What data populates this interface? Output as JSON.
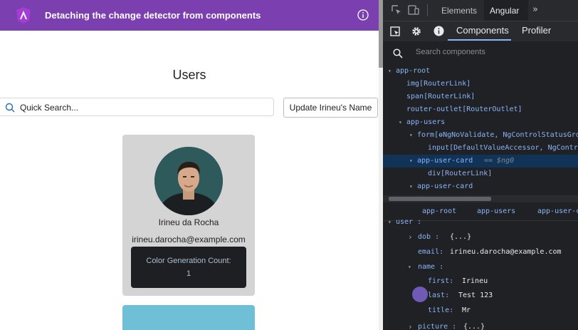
{
  "app": {
    "title": "Detaching the change detector from components",
    "heading": "Users",
    "search": {
      "value": "Quick Search..."
    },
    "update_button": "Update Irineu's Name",
    "user_card": {
      "name": "Irineu da Rocha",
      "email": "irineu.darocha@example.com",
      "counter_label": "Color Generation Count:",
      "counter_value": "1"
    }
  },
  "devtools": {
    "tabs": [
      "Elements",
      "Angular"
    ],
    "more_tabs": "»",
    "angular_tabs": [
      "Components",
      "Profiler"
    ],
    "search_placeholder": "Search components",
    "tree": [
      {
        "arrow": "▾",
        "label": "app-root"
      },
      {
        "arrow": "",
        "label": "img[RouterLink]"
      },
      {
        "arrow": "",
        "label": "span[RouterLink]"
      },
      {
        "arrow": "",
        "label": "router-outlet[RouterOutlet]"
      },
      {
        "arrow": "▾",
        "label": "app-users"
      },
      {
        "arrow": "▾",
        "label": "form[ɵNgNoValidate, NgControlStatusGro"
      },
      {
        "arrow": "",
        "label": "input[DefaultValueAccessor, NgContro"
      },
      {
        "arrow": "▾",
        "label": "app-user-card",
        "note": "== $ng0"
      },
      {
        "arrow": "",
        "label": "div[RouterLink]"
      },
      {
        "arrow": "▾",
        "label": "app-user-card"
      }
    ],
    "breadcrumbs": [
      "app-root",
      "app-users",
      "app-user-ca"
    ],
    "properties": [
      {
        "arrow": "▾",
        "key": "user :",
        "value": ""
      },
      {
        "arrow": "›",
        "key": "dob :",
        "value": "{...}"
      },
      {
        "arrow": "",
        "key": "email:",
        "value": "irineu.darocha@example.com"
      },
      {
        "arrow": "▾",
        "key": "name :",
        "value": ""
      },
      {
        "arrow": "",
        "key": "first:",
        "value": "Irineu"
      },
      {
        "arrow": "",
        "key": "last:",
        "value": "Test 123"
      },
      {
        "arrow": "",
        "key": "title:",
        "value": "Mr"
      },
      {
        "arrow": "›",
        "key": "picture :",
        "value": "{...}"
      }
    ]
  }
}
